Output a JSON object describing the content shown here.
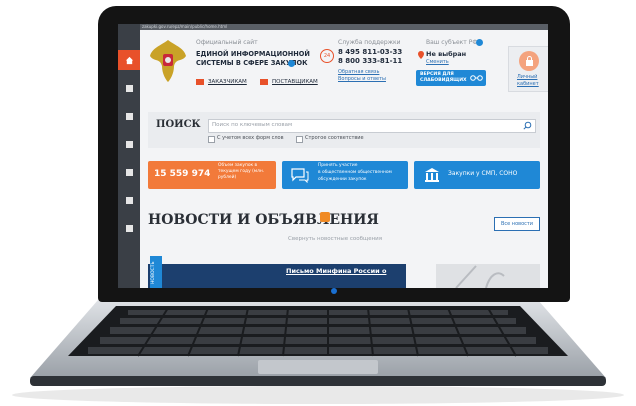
{
  "browser": {
    "url": "zakupki.gov.ru/epz/main/public/home.html"
  },
  "header": {
    "official_site": "Официальный сайт",
    "system_name_line1": "ЕДИНОЙ ИНФОРМАЦИОННОЙ",
    "system_name_line2": "СИСТЕМЫ В СФЕРЕ ЗАКУПОК",
    "customers": "ЗАКАЗЧИКАМ",
    "suppliers": "ПОСТАВЩИКАМ",
    "support_title": "Служба поддержки",
    "support_24": "24",
    "phone1": "8 495 811-03-33",
    "phone2": "8 800 333-81-11",
    "feedback": "Обратная связь",
    "qa": "Вопросы и ответы",
    "subject_title": "Ваш субъект РФ",
    "subject_value": "Не выбран",
    "subject_change": "Сменить",
    "visually_impaired_line1": "ВЕРСИЯ ДЛЯ",
    "visually_impaired_line2": "СЛАБОВИДЯЩИХ",
    "cabinet_line1": "Личный",
    "cabinet_line2": "кабинет"
  },
  "search": {
    "label": "ПОИСК",
    "placeholder": "Поиск по ключевым словам",
    "option_all_forms": "С учетом всех форм слов",
    "option_exact": "Строгое соответствие"
  },
  "cards": {
    "count": "15 559 974",
    "count_caption_line1": "Объем закупок в",
    "count_caption_line2": "текущем году (млн.",
    "count_caption_line3": "рублей)",
    "discussion_line1": "Принять участие",
    "discussion_line2": "в общественном общественном",
    "discussion_line3": "обсуждении закупок",
    "smp": "Закупки у СМП, СОНО"
  },
  "news": {
    "title": "НОВОСТИ И ОБЪЯВЛЕНИЯ",
    "all_news": "Все новости",
    "collapse": "Свернуть новостные сообщения",
    "tag": "НОВОСТЬ",
    "headline_line1": "Письмо Минфина России о"
  },
  "colors": {
    "accent_orange": "#e8512a",
    "brand_blue": "#1f88d6",
    "sidebar_dark": "#3a3f46"
  },
  "icons": {
    "home": "home-icon",
    "info": "info-icon",
    "lock": "lock-icon",
    "search": "search-icon",
    "rss": "rss-icon",
    "glasses": "glasses-icon",
    "building": "building-icon"
  }
}
